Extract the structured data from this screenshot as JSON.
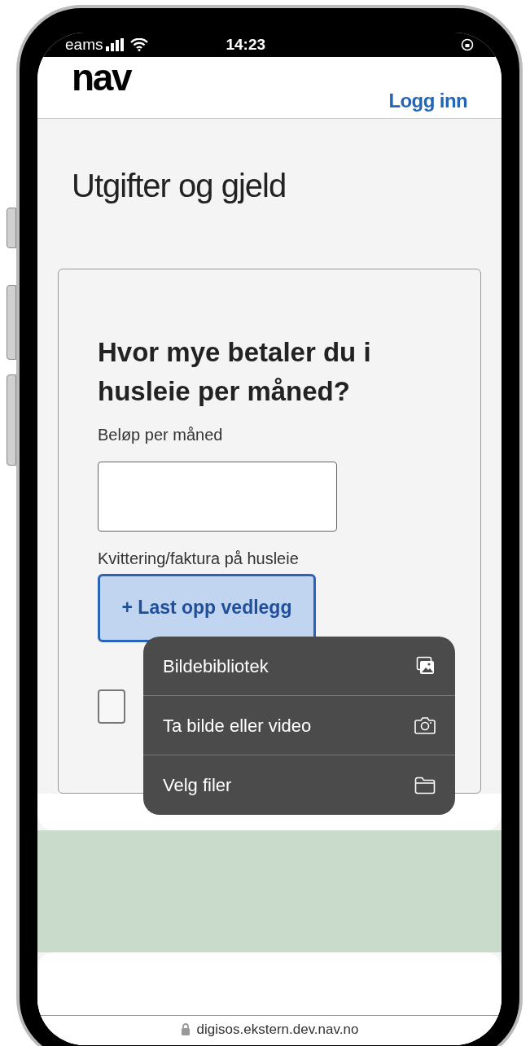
{
  "status_bar": {
    "carrier": "eams",
    "time": "14:23"
  },
  "header": {
    "logo": "nav",
    "login": "Logg inn"
  },
  "page_title": "Utgifter og gjeld",
  "question": {
    "title": "Hvor mye betaler du i husleie per måned?",
    "amount_label": "Beløp per måned",
    "receipt_label": "Kvittering/faktura på husleie",
    "upload_button": "+ Last opp vedlegg",
    "checkbox": {
      "checked": false
    }
  },
  "menu": [
    {
      "label": "Bildebibliotek",
      "kind": "photos"
    },
    {
      "label": "Ta bilde eller video",
      "kind": "camera"
    },
    {
      "label": "Velg filer",
      "kind": "folder"
    }
  ],
  "address_bar": {
    "url": "digisos.ekstern.dev.nav.no"
  }
}
